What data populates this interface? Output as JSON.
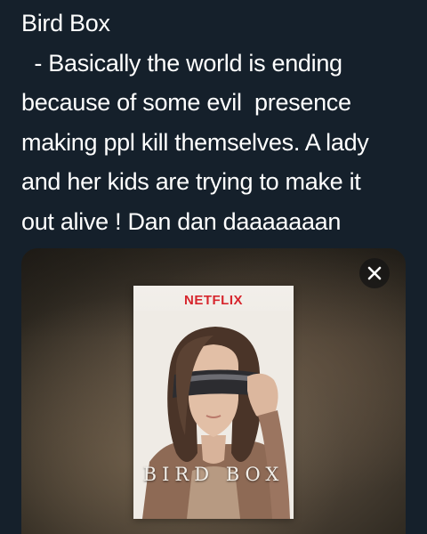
{
  "tweet": {
    "lines": [
      "Bird Box",
      "  - Basically the world is ending",
      "because of some evil  presence",
      "making ppl kill themselves. A lady",
      "and her kids are trying to make it",
      "out alive ! Dan dan daaaaaaan"
    ]
  },
  "media": {
    "close_icon": "close-x-icon",
    "poster": {
      "brand": "NETFLIX",
      "title": "BIRD BOX"
    }
  },
  "colors": {
    "background": "#15202b",
    "text": "#ffffff",
    "netflix_red": "#d7262d"
  }
}
